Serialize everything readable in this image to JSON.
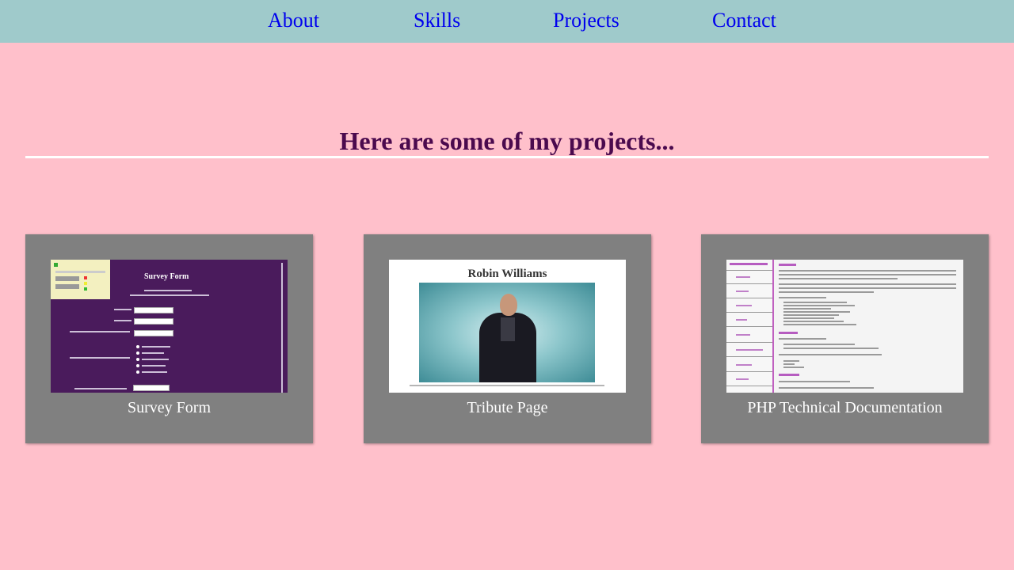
{
  "nav": {
    "about": "About",
    "skills": "Skills",
    "projects": "Projects",
    "contact": "Contact"
  },
  "projects_section": {
    "heading": "Here are some of my projects...",
    "cards": [
      {
        "caption": "Survey Form",
        "thumbnail": {
          "title": "Survey Form"
        }
      },
      {
        "caption": "Tribute Page",
        "thumbnail": {
          "title": "Robin Williams"
        }
      },
      {
        "caption": "PHP Technical Documentation",
        "thumbnail": {}
      }
    ]
  },
  "colors": {
    "page_background": "#ffc0cb",
    "nav_background": "#9fcacb",
    "nav_link": "#0000ee",
    "heading": "#4b0a4e",
    "card_background": "#808080",
    "caption_text": "#ffffff"
  }
}
